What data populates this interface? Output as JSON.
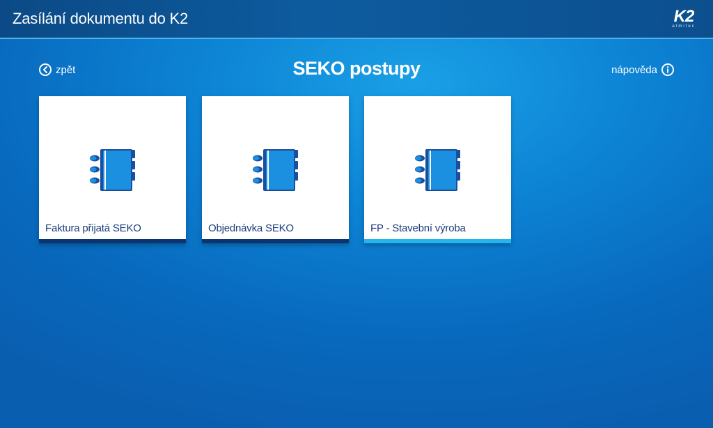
{
  "window": {
    "title": "Zasílání dokumentu do K2",
    "logo_main": "K2",
    "logo_sub": "atmitec"
  },
  "nav": {
    "back_label": "zpět",
    "back_icon": "chevron-left-circle-icon",
    "help_label": "nápověda",
    "help_icon": "info-circle-icon"
  },
  "page": {
    "title": "SEKO postupy"
  },
  "tiles": [
    {
      "label": "Faktura přijatá SEKO",
      "icon": "notebook-icon",
      "active": false
    },
    {
      "label": "Objednávka SEKO",
      "icon": "notebook-icon",
      "active": false
    },
    {
      "label": "FP - Stavební výroba",
      "icon": "notebook-icon",
      "active": true
    }
  ],
  "colors": {
    "background": "#0d83d4",
    "titlebar": "#0c4f8f",
    "tile_text": "#1b3d7a",
    "stripe_default": "#0b3570",
    "stripe_active": "#23b5ee",
    "icon_dark": "#1a4e9e",
    "icon_light": "#1b8fe0"
  }
}
